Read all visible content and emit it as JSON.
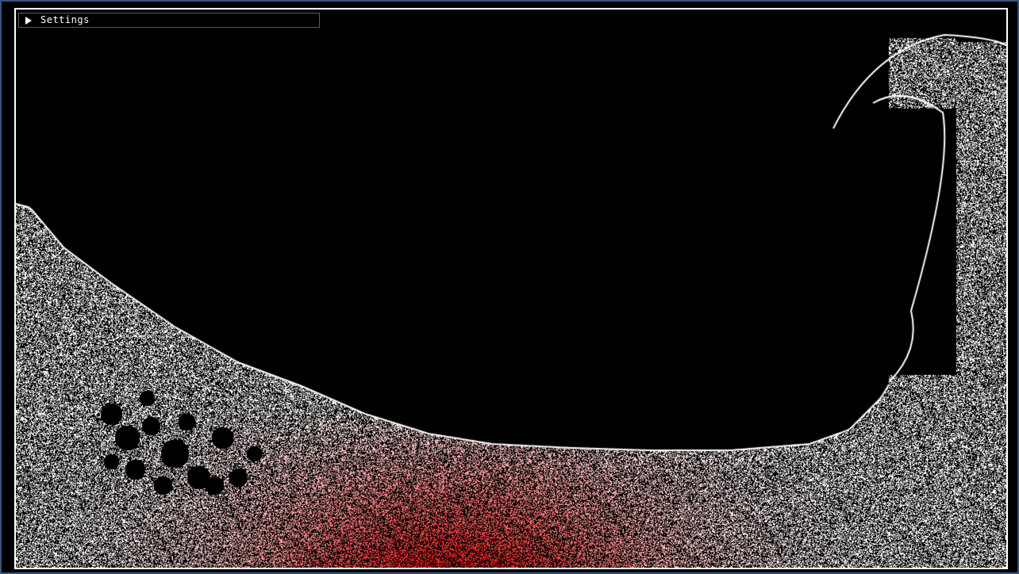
{
  "settings": {
    "label": "Settings",
    "expanded": false,
    "toggle_icon": "triangle-right-icon"
  },
  "simulation": {
    "particle_color": "#ffffff",
    "heat_color": "#e02020",
    "background_color": "#000000",
    "window_border_color": "#35557a"
  }
}
